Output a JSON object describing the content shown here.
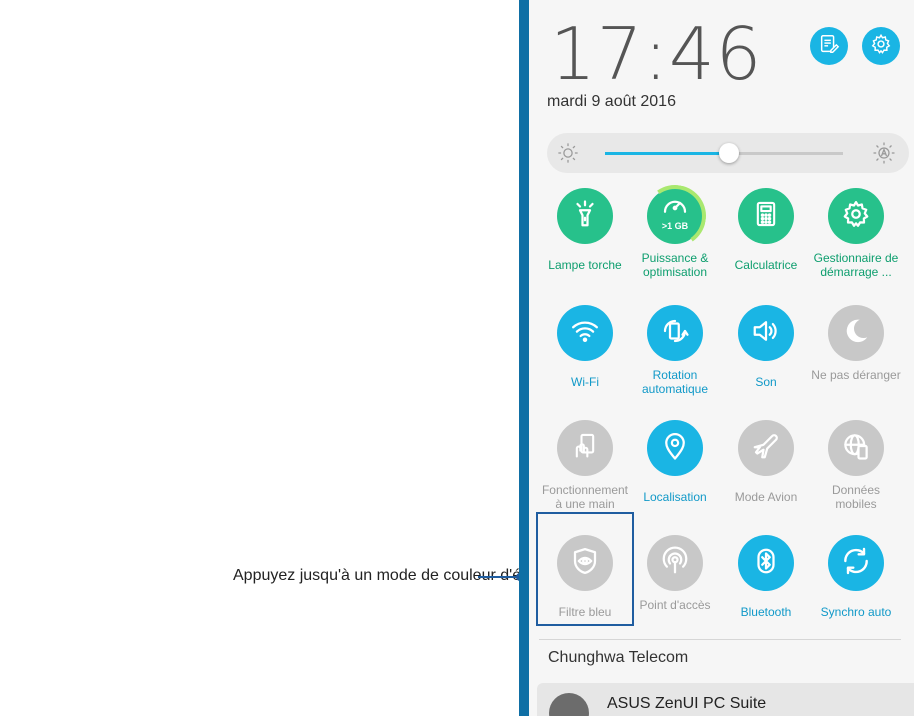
{
  "callout": {
    "text": "Appuyez jusqu'à un mode de couleur d'écran préféré"
  },
  "header": {
    "time": "17:46",
    "date": "mardi 9 août 2016",
    "notes_icon": "notes-icon",
    "settings_icon": "gear-icon"
  },
  "brightness": {
    "level": 0.52,
    "low_icon": "sun-low-icon",
    "auto_icon": "auto-brightness-icon"
  },
  "tiles": [
    {
      "label": "Lampe torche",
      "icon": "flashlight-icon",
      "state": "on",
      "color": "#27c18b"
    },
    {
      "label": "Puissance & optimisation",
      "icon": "speedometer-icon",
      "badge": ">1 GB",
      "state": "on",
      "color": "#27c18b"
    },
    {
      "label": "Calculatrice",
      "icon": "calculator-icon",
      "state": "on",
      "color": "#27c18b"
    },
    {
      "label": "Gestionnaire de démarrage ...",
      "icon": "gear-icon",
      "state": "on",
      "color": "#27c18b"
    },
    {
      "label": "Wi-Fi",
      "icon": "wifi-icon",
      "state": "on",
      "color": "#1ab5e4"
    },
    {
      "label": "Rotation automatique",
      "icon": "rotation-icon",
      "state": "on",
      "color": "#1ab5e4"
    },
    {
      "label": "Son",
      "icon": "speaker-icon",
      "state": "on",
      "color": "#1ab5e4"
    },
    {
      "label": "Ne pas déranger",
      "icon": "moon-icon",
      "state": "off",
      "color": "#c8c8c8"
    },
    {
      "label": "Fonctionnement à une main",
      "icon": "one-hand-icon",
      "state": "off",
      "color": "#c8c8c8"
    },
    {
      "label": "Localisation",
      "icon": "location-pin-icon",
      "state": "on",
      "color": "#1ab5e4"
    },
    {
      "label": "Mode Avion",
      "icon": "airplane-icon",
      "state": "off",
      "color": "#c8c8c8"
    },
    {
      "label": "Données mobiles",
      "icon": "globe-icon",
      "state": "off",
      "color": "#c8c8c8"
    },
    {
      "label": "Filtre bleu",
      "icon": "eye-shield-icon",
      "state": "off",
      "color": "#c8c8c8"
    },
    {
      "label": "Point d'accès",
      "icon": "hotspot-icon",
      "state": "off",
      "color": "#c8c8c8"
    },
    {
      "label": "Bluetooth",
      "icon": "bluetooth-icon",
      "state": "on",
      "color": "#1ab5e4"
    },
    {
      "label": "Synchro auto",
      "icon": "sync-icon",
      "state": "on",
      "color": "#1ab5e4"
    }
  ],
  "colors": {
    "accent_blue": "#1ab5e4",
    "accent_green": "#27c18b",
    "off_gray": "#c8c8c8",
    "label_on_green": "#0d9e6e",
    "label_on_blue": "#1199c8",
    "label_off": "#9a9a9a",
    "callout_blue": "#1f5da0"
  },
  "carrier": "Chunghwa Telecom",
  "notification": {
    "title": "ASUS ZenUI PC Suite"
  }
}
